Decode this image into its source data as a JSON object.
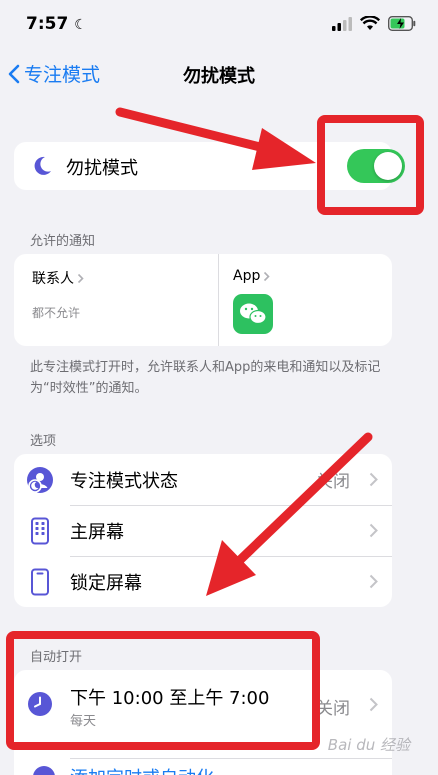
{
  "status": {
    "time": "7:57"
  },
  "nav": {
    "back_label": "专注模式",
    "title": "勿扰模式"
  },
  "dnd_toggle": {
    "label": "勿扰模式",
    "on": true
  },
  "allowed_notifications": {
    "header": "允许的通知",
    "people": {
      "title": "联系人",
      "subtitle": "都不允许"
    },
    "apps": {
      "title": "App"
    },
    "footnote": "此专注模式打开时，允许联系人和App的来电和通知以及标记为“时效性”的通知。"
  },
  "options": {
    "header": "选项",
    "items": [
      {
        "label": "专注模式状态",
        "value": "关闭"
      },
      {
        "label": "主屏幕"
      },
      {
        "label": "锁定屏幕"
      }
    ]
  },
  "auto_on": {
    "header": "自动打开",
    "schedule": {
      "title": "下午 10:00 至上午 7:00",
      "subtitle": "每天",
      "value": "关闭"
    },
    "add_label": "添加定时或自动化"
  },
  "watermark": "Bai du 经验",
  "colors": {
    "accent": "#1a7cf2",
    "toggle_on": "#34c759",
    "annotation": "#e5252a",
    "moon": "#5856d6"
  }
}
